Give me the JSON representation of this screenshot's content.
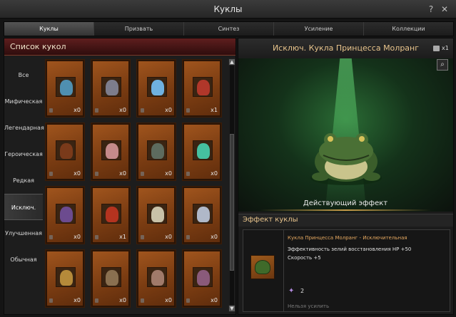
{
  "window": {
    "title": "Куклы",
    "help": "?",
    "close": "✕"
  },
  "tabs": [
    "Куклы",
    "Призвать",
    "Синтез",
    "Усиление",
    "Коллекции"
  ],
  "active_tab": 0,
  "doll_list": {
    "header": "Список кукол",
    "categories": [
      "Все",
      "Мифическая",
      "Легендарная",
      "Героическая",
      "Редкая",
      "Исключ.",
      "Улучшенная",
      "Обычная"
    ],
    "active_category": 5,
    "cards": [
      {
        "count": "x0",
        "color": "#4f8fb0"
      },
      {
        "count": "x0",
        "color": "#7d7d8c"
      },
      {
        "count": "x0",
        "color": "#6fb1e0"
      },
      {
        "count": "x1",
        "color": "#b0372a"
      },
      {
        "count": "x0",
        "color": "#7a3a1a"
      },
      {
        "count": "x0",
        "color": "#c48a8a"
      },
      {
        "count": "x0",
        "color": "#5d6b5e"
      },
      {
        "count": "x0",
        "color": "#45c0a0"
      },
      {
        "count": "x0",
        "color": "#6c4b8f"
      },
      {
        "count": "x1",
        "color": "#b4331f"
      },
      {
        "count": "x0",
        "color": "#c9c2a8"
      },
      {
        "count": "x0",
        "color": "#b0b8c8"
      },
      {
        "count": "x0",
        "color": "#b58a3a"
      },
      {
        "count": "x0",
        "color": "#8a7050"
      },
      {
        "count": "x0",
        "color": "#a07a6a"
      },
      {
        "count": "x0",
        "color": "#8a5a7a"
      }
    ]
  },
  "detail": {
    "name": "Исключ. Кукла Принцесса Молранг",
    "book_count": "x1",
    "active_effect": "Действующий эффект",
    "effect_header": "Эффект куклы",
    "effect_name": "Кукла Принцесса Молранг - Исключительная",
    "effects": [
      "Эффективность зелий восстановления HP +50",
      "Скорость +5"
    ],
    "gem_count": "2",
    "cannot_enhance": "Нельзя усилить"
  }
}
